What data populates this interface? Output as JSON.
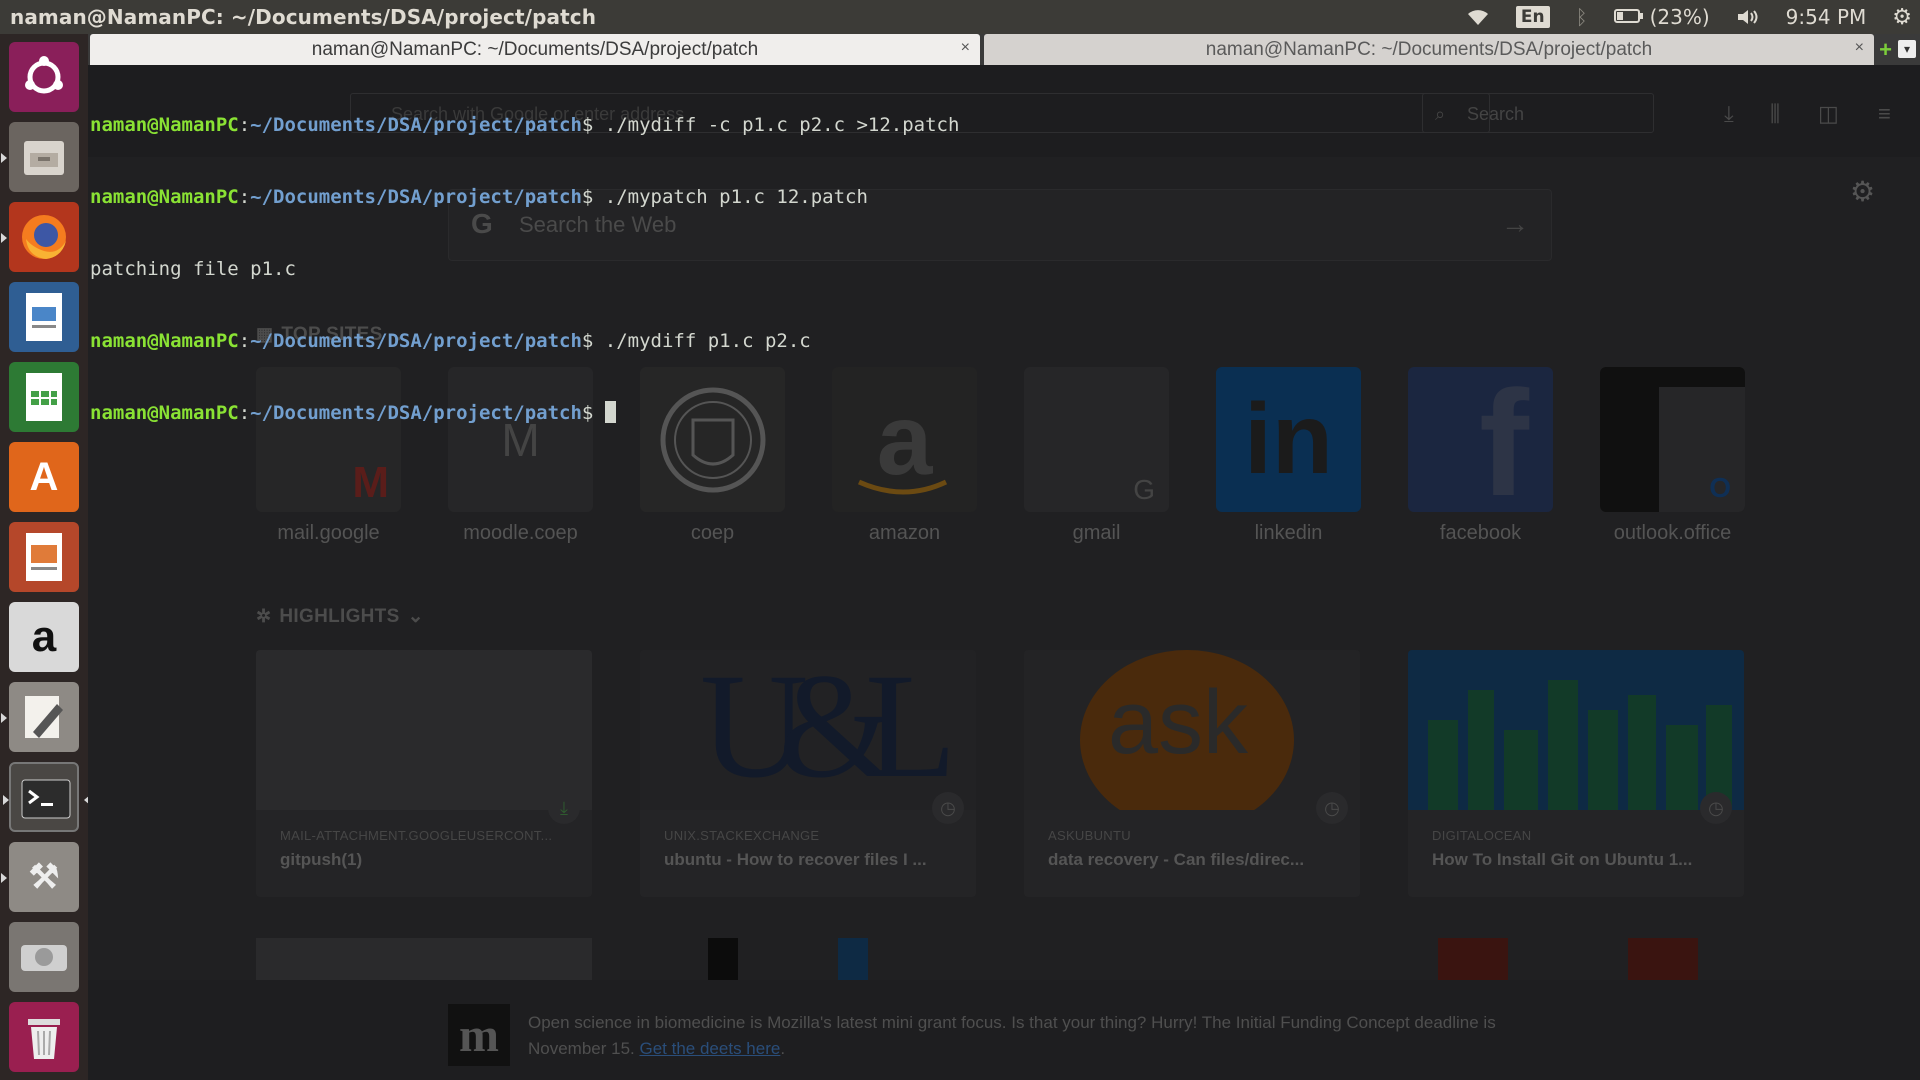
{
  "top_panel": {
    "window_title": "naman@NamanPC: ~/Documents/DSA/project/patch",
    "language": "En",
    "battery": "(23%)",
    "clock": "9:54 PM"
  },
  "launcher": {
    "items": [
      {
        "name": "ubuntu-dash",
        "label": "◌"
      },
      {
        "name": "files",
        "label": "▣"
      },
      {
        "name": "firefox",
        "label": "◉"
      },
      {
        "name": "libreoffice-writer",
        "label": "▤"
      },
      {
        "name": "libreoffice-calc",
        "label": "▦"
      },
      {
        "name": "ubuntu-software",
        "label": "A"
      },
      {
        "name": "libreoffice-impress",
        "label": "▥"
      },
      {
        "name": "amazon",
        "label": "a"
      },
      {
        "name": "text-editor",
        "label": "✎"
      },
      {
        "name": "terminal",
        "label": ">_"
      },
      {
        "name": "system-settings",
        "label": "⚒"
      },
      {
        "name": "disks",
        "label": "◍"
      },
      {
        "name": "trash",
        "label": "🗑"
      }
    ]
  },
  "tabs": [
    {
      "label": "naman@NamanPC: ~/Documents/DSA/project/patch",
      "close": "×"
    },
    {
      "label": "naman@NamanPC: ~/Documents/DSA/project/patch",
      "close": "×"
    }
  ],
  "tab_add": "+",
  "tab_menu": "▾",
  "terminal": {
    "user": "naman@NamanPC",
    "colon": ":",
    "path": "~/Documents/DSA/project/patch",
    "prompt_symbol": "$ ",
    "lines": [
      {
        "type": "prompt",
        "cmd": "./mydiff -c p1.c p2.c >12.patch"
      },
      {
        "type": "prompt",
        "cmd": "./mypatch p1.c 12.patch"
      },
      {
        "type": "output",
        "text": "patching file p1.c"
      },
      {
        "type": "prompt",
        "cmd": "./mydiff p1.c p2.c"
      },
      {
        "type": "prompt",
        "cmd": ""
      }
    ]
  },
  "firefox": {
    "url_placeholder": "Search with Google or enter address",
    "search_placeholder": "Search",
    "web_search_placeholder": "Search the Web",
    "top_sites_title": "TOP SITES",
    "top_sites": [
      {
        "label": "mail.google",
        "tile": "M"
      },
      {
        "label": "moodle.coep",
        "tile": "M"
      },
      {
        "label": "coep",
        "tile": "⛨"
      },
      {
        "label": "amazon",
        "tile": "a"
      },
      {
        "label": "gmail",
        "tile": "G"
      },
      {
        "label": "linkedin",
        "tile": "in"
      },
      {
        "label": "facebook",
        "tile": "f"
      },
      {
        "label": "outlook.office",
        "tile": "O"
      }
    ],
    "highlights_title": "HIGHLIGHTS",
    "highlights": [
      {
        "host": "MAIL-ATTACHMENT.GOOGLEUSERCONT...",
        "title": "gitpush(1)",
        "img": ""
      },
      {
        "host": "UNIX.STACKEXCHANGE",
        "title": "ubuntu - How to recover files I ...",
        "img": "U&L"
      },
      {
        "host": "ASKUBUNTU",
        "title": "data recovery - Can files/direc...",
        "img": "ask"
      },
      {
        "host": "DIGITALOCEAN",
        "title": "How To Install Git on Ubuntu 1...",
        "img": ""
      }
    ],
    "notice": {
      "logo": "m",
      "text": "Open science in biomedicine is Mozilla's latest mini grant focus. Is that your thing? Hurry! The Initial Funding Concept deadline is November 15. ",
      "link": "Get the deets here",
      "suffix": "."
    }
  },
  "colors": {
    "panel_bg": "#3c3b37",
    "terminal_user": "#8ae234",
    "terminal_path": "#729fcf",
    "linkedin": "#0a66c2",
    "facebook": "#3b5998"
  }
}
